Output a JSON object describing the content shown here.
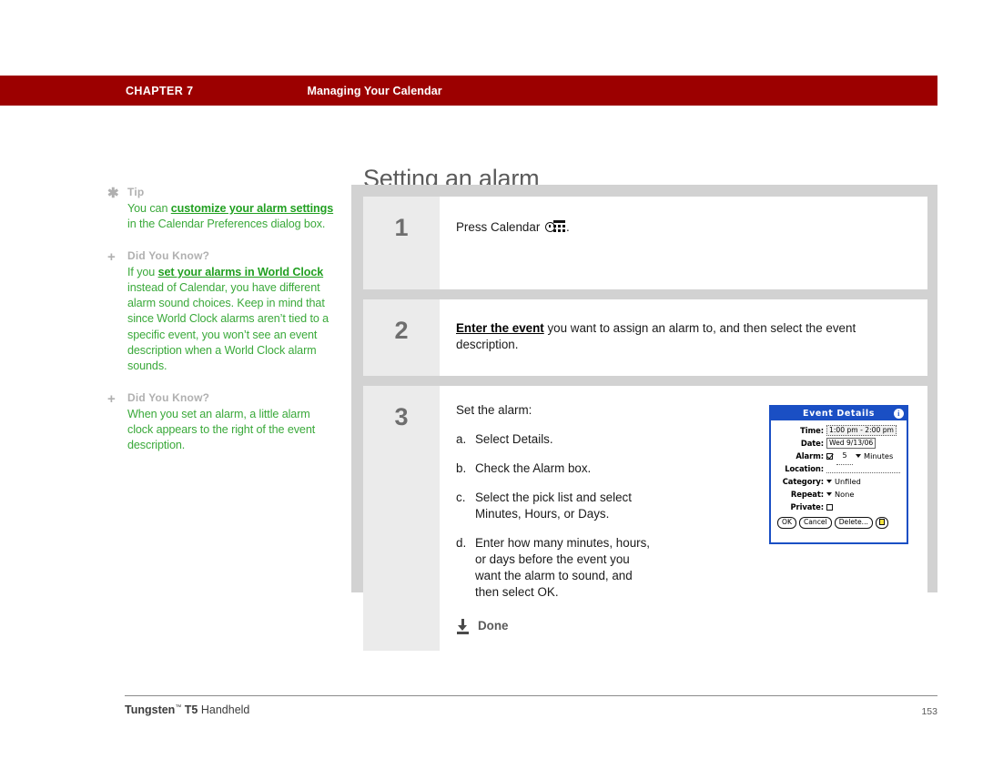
{
  "header": {
    "chapter": "CHAPTER 7",
    "section": "Managing Your Calendar",
    "bar_color": "#9c0000"
  },
  "page_title": "Setting an alarm",
  "sidebar": {
    "tips": [
      {
        "marker": "asterisk-icon",
        "heading": "Tip",
        "segments": [
          {
            "text": "You can ",
            "link": false
          },
          {
            "text": "customize your alarm settings",
            "link": true
          },
          {
            "text": " in the Calendar Preferences dialog box.",
            "link": false
          }
        ]
      },
      {
        "marker": "plus-icon",
        "heading": "Did You Know?",
        "segments": [
          {
            "text": "If you ",
            "link": false
          },
          {
            "text": "set your alarms in World Clock",
            "link": true
          },
          {
            "text": " instead of Calendar, you have different alarm sound choices. Keep in mind that since World Clock alarms aren’t tied to a specific event, you won’t see an event description when a World Clock alarm sounds.",
            "link": false
          }
        ]
      },
      {
        "marker": "plus-icon",
        "heading": "Did You Know?",
        "segments": [
          {
            "text": "When you set an alarm, a little alarm clock appears to the right of the event description.",
            "link": false
          }
        ]
      }
    ],
    "text_color": "#3aa93a",
    "heading_color": "#b0b0b0"
  },
  "steps": [
    {
      "number": "1",
      "segments": [
        {
          "text": "Press Calendar ",
          "link": false
        }
      ],
      "icon": "calendar-icon",
      "trailing": "."
    },
    {
      "number": "2",
      "segments": [
        {
          "text": "Enter the event",
          "link": true
        },
        {
          "text": " you want to assign an alarm to, and then select the event description.",
          "link": false
        }
      ]
    },
    {
      "number": "3",
      "intro": "Set the alarm:",
      "sublist": [
        {
          "label": "a.",
          "text": "Select Details."
        },
        {
          "label": "b.",
          "text": "Check the Alarm box."
        },
        {
          "label": "c.",
          "text": "Select the pick list and select Minutes, Hours, or Days."
        },
        {
          "label": "d.",
          "text": "Enter how many minutes, hours, or days before the event you want the alarm to sound, and then select OK."
        }
      ],
      "done_label": "Done"
    }
  ],
  "dialog": {
    "title": "Event Details",
    "info_glyph": "i",
    "rows": [
      {
        "label": "Time:",
        "value": "1:00 pm - 2:00 pm",
        "kind": "dashbox"
      },
      {
        "label": "Date:",
        "value": "Wed 9/13/06",
        "kind": "solidbox"
      },
      {
        "label": "Alarm:",
        "checkbox": "checked",
        "amount": "5",
        "unit": "Minutes",
        "kind": "alarm"
      },
      {
        "label": "Location:",
        "value": "",
        "kind": "underline"
      },
      {
        "label": "Category:",
        "value": "Unfiled",
        "kind": "picklist"
      },
      {
        "label": "Repeat:",
        "value": "None",
        "kind": "picklist"
      },
      {
        "label": "Private:",
        "checkbox": "unchecked",
        "kind": "checkbox"
      }
    ],
    "buttons": [
      {
        "label": "OK"
      },
      {
        "label": "Cancel"
      },
      {
        "label": "Delete..."
      }
    ],
    "note_button": "note-icon",
    "accent_color": "#1a4fc4"
  },
  "footer": {
    "product_bold": "Tungsten",
    "trademark": "™",
    "model": " T5",
    "product_rest": " Handheld",
    "page_number": "153"
  }
}
